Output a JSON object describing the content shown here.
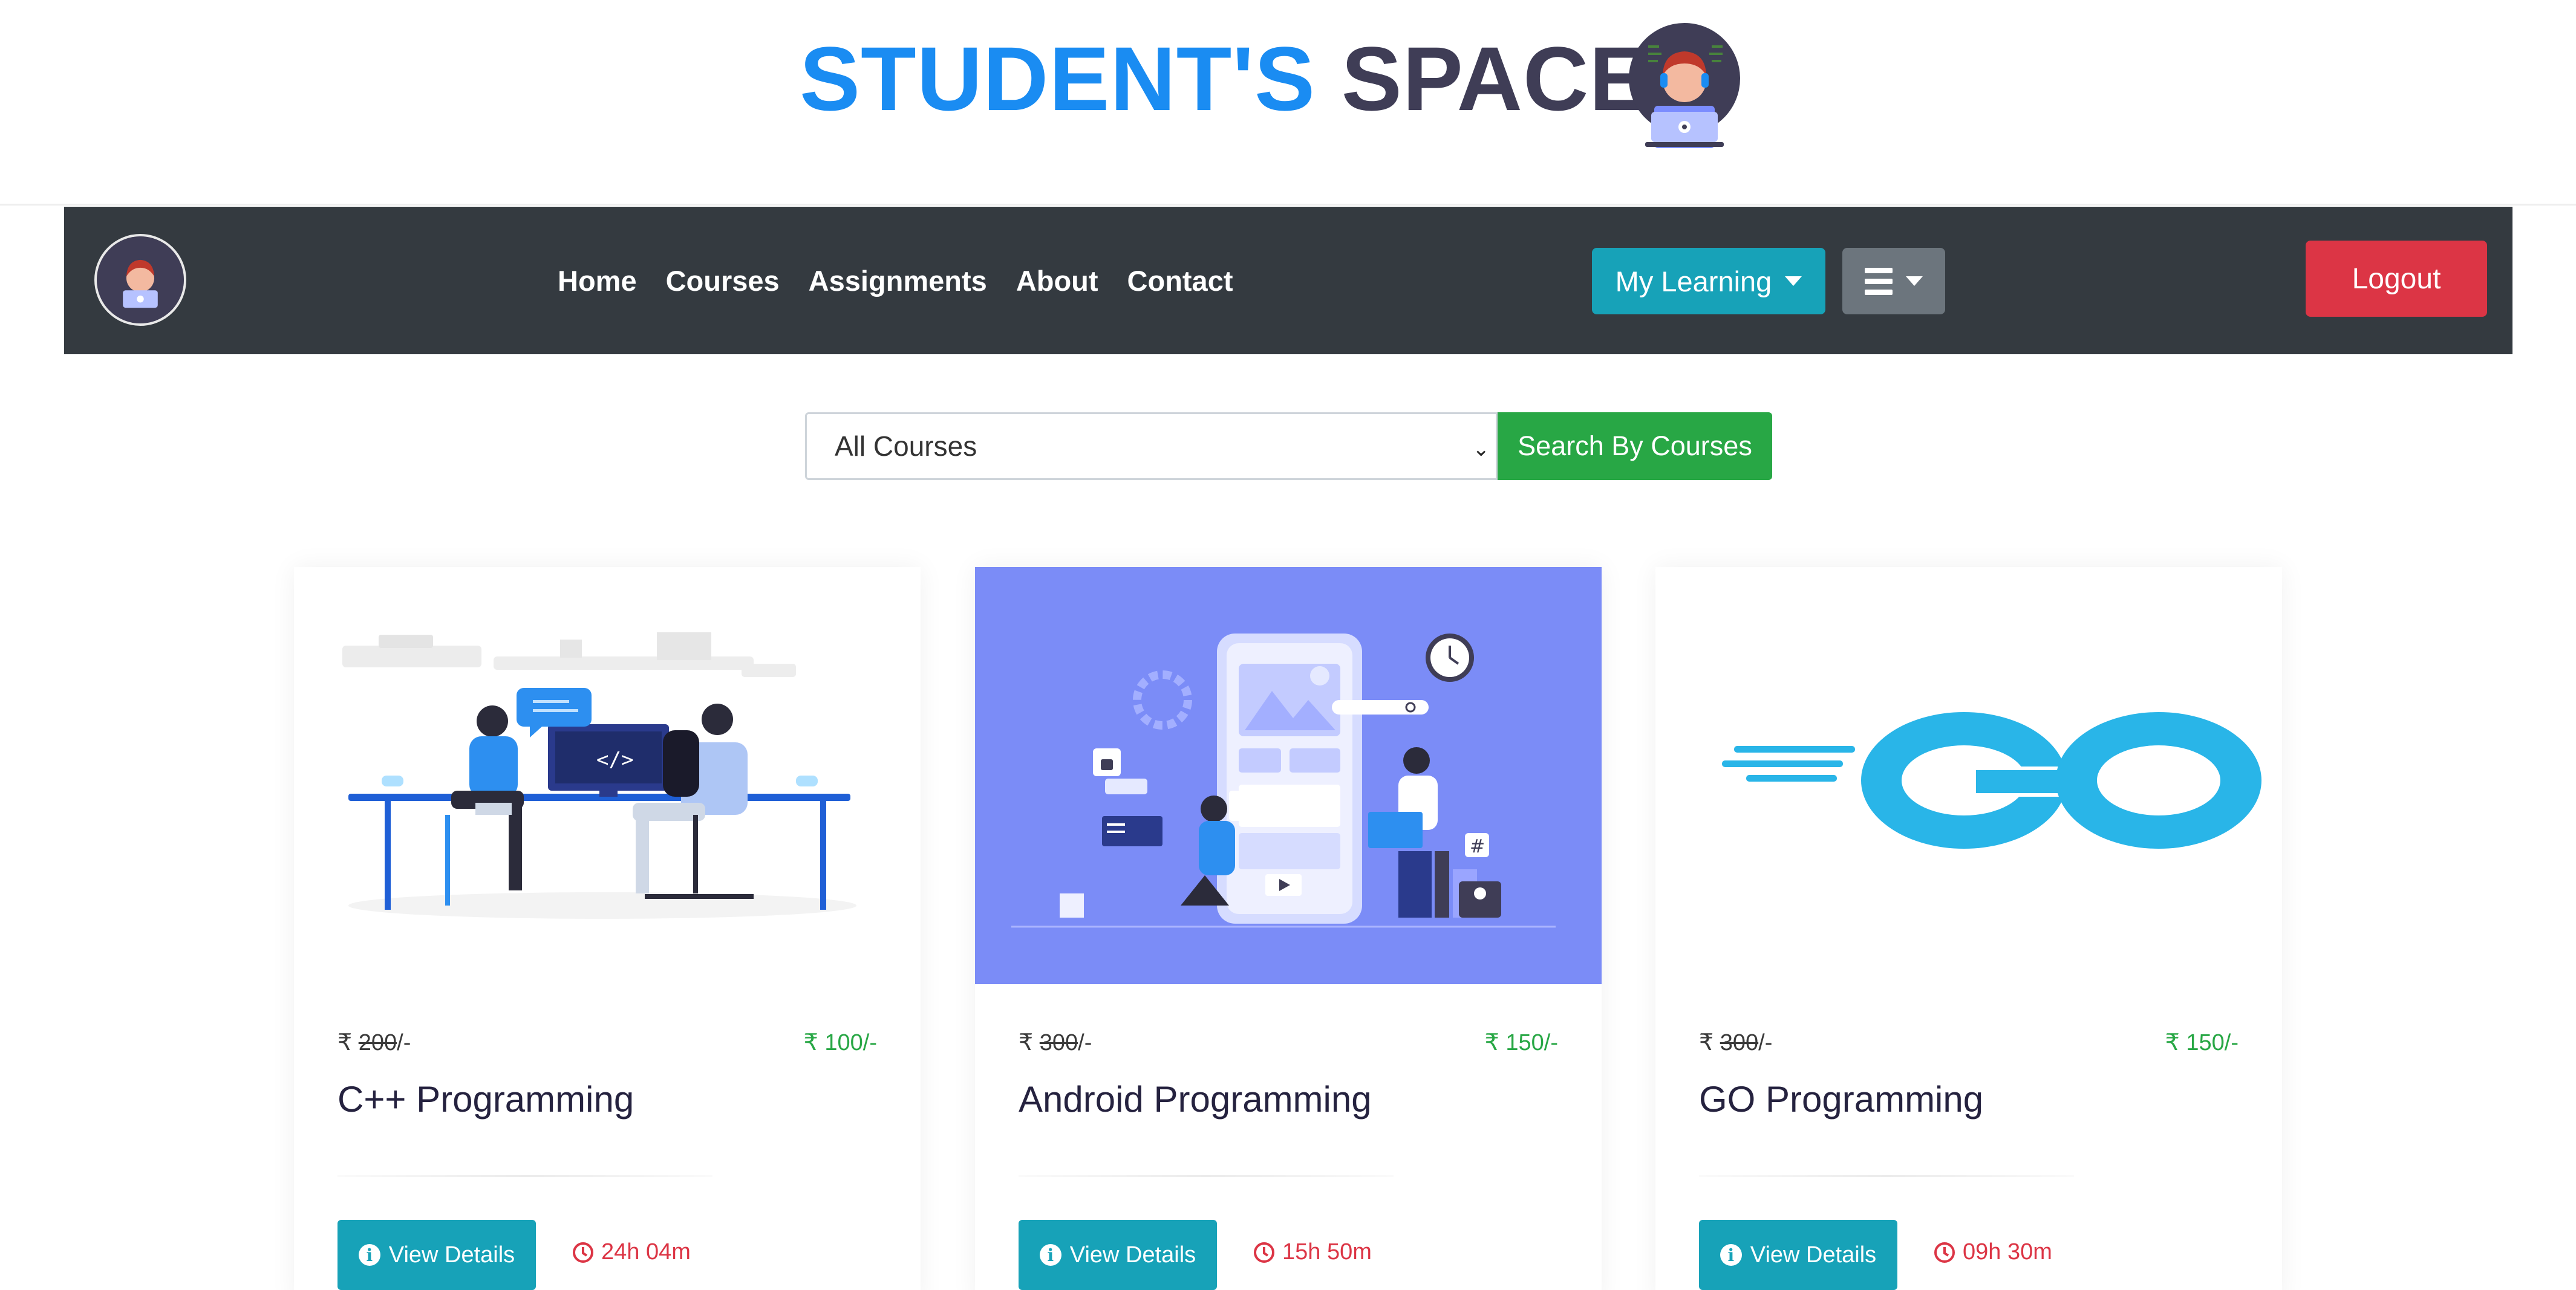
{
  "header": {
    "title_part1": "STUDENT'S",
    "title_part2": "SPACE"
  },
  "navbar": {
    "links": [
      "Home",
      "Courses",
      "Assignments",
      "About",
      "Contact"
    ],
    "my_learning_label": "My Learning",
    "logout_label": "Logout"
  },
  "search": {
    "select_value": "All Courses",
    "button_label": "Search By Courses"
  },
  "courses": [
    {
      "currency": "₹",
      "old_price": "200",
      "new_price": "100",
      "suffix": "/-",
      "title": "C++ Programming",
      "details_label": "View Details",
      "duration": "24h 04m"
    },
    {
      "currency": "₹",
      "old_price": "300",
      "new_price": "150",
      "suffix": "/-",
      "title": "Android Programming",
      "details_label": "View Details",
      "duration": "15h 50m"
    },
    {
      "currency": "₹",
      "old_price": "300",
      "new_price": "150",
      "suffix": "/-",
      "title": "GO Programming",
      "details_label": "View Details",
      "duration": "09h 30m"
    }
  ],
  "colors": {
    "brand_blue": "#1a8cf2",
    "brand_dark": "#3f3d56",
    "navbar_bg": "#343a40",
    "info": "#17a2b8",
    "secondary": "#6c757d",
    "danger": "#dc3545",
    "success": "#28a745"
  }
}
